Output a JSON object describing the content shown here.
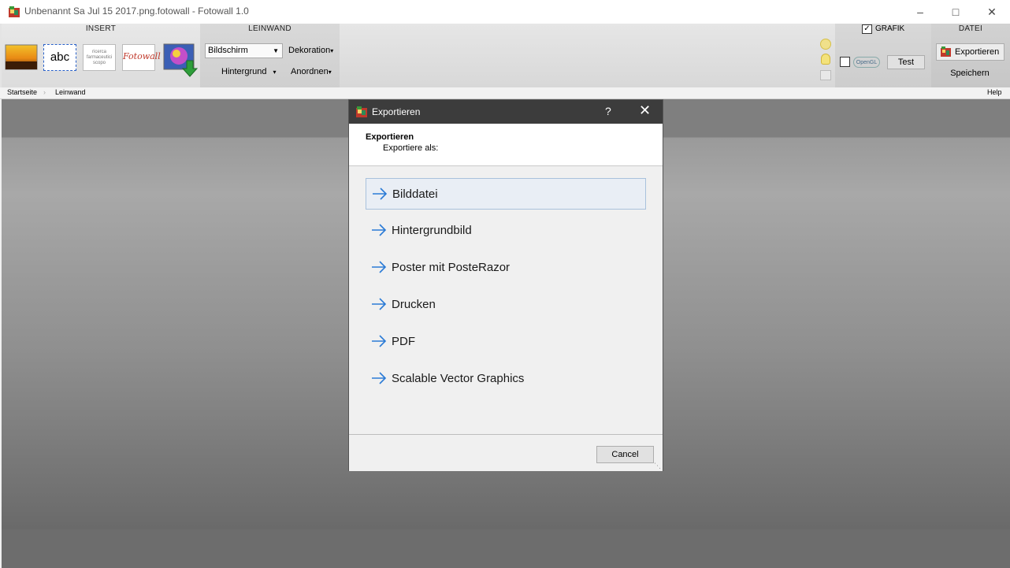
{
  "window": {
    "title": "Unbenannt Sa Jul 15 2017.png.fotowall - Fotowall 1.0"
  },
  "ribbon": {
    "insert_title": "INSERT",
    "leinwand_title": "LEINWAND",
    "grafik_title": "GRAFIK",
    "datei_title": "DATEI",
    "text_tool": "abc",
    "wordcloud_text": "ricerca farmaceutici scopo",
    "fotowall_tool": "Fotowall",
    "mode_select": "Bildschirm",
    "dekoration": "Dekoration",
    "hintergrund": "Hintergrund",
    "anordnen": "Anordnen",
    "opengl": "OpenGL",
    "test": "Test",
    "exportieren": "Exportieren",
    "speichern": "Speichern"
  },
  "breadcrumb": {
    "items": [
      "Startseite",
      "Leinwand"
    ],
    "help": "Help"
  },
  "dialog": {
    "title": "Exportieren",
    "help": "?",
    "heading": "Exportieren",
    "subheading": "Exportiere als:",
    "options": [
      {
        "label": "Bilddatei"
      },
      {
        "label": "Hintergrundbild"
      },
      {
        "label": "Poster mit PosteRazor"
      },
      {
        "label": "Drucken"
      },
      {
        "label": "PDF"
      },
      {
        "label": "Scalable Vector Graphics"
      }
    ],
    "cancel": "Cancel"
  },
  "colors": {
    "accent": "#2b7bd6",
    "dialog_title_bg": "#3c3c3c"
  }
}
